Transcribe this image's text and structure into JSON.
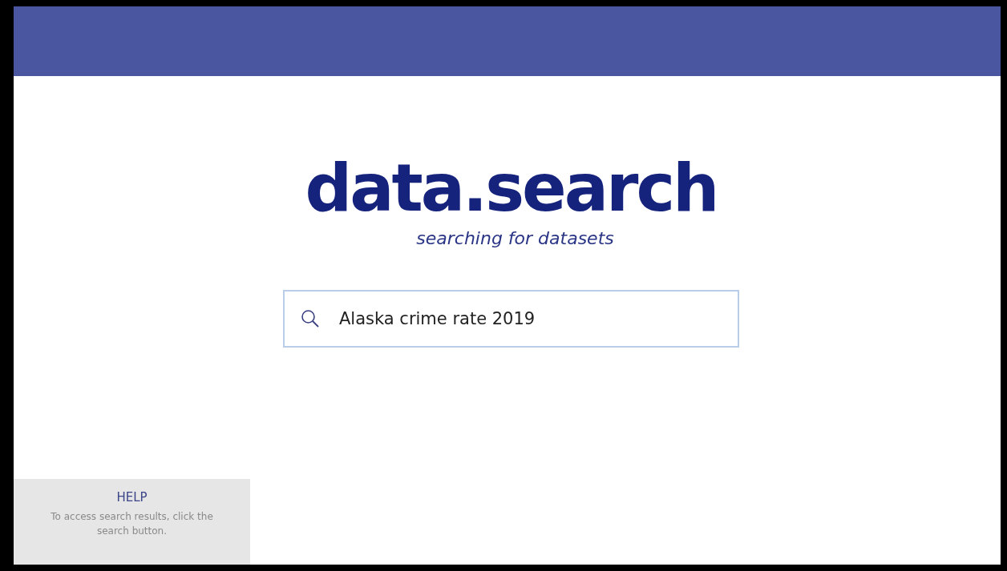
{
  "logo": {
    "title": "data.search",
    "tagline": "searching for datasets"
  },
  "search": {
    "value": "Alaska crime rate 2019"
  },
  "help": {
    "title": "HELP",
    "text": "To access search results, click the search button."
  }
}
